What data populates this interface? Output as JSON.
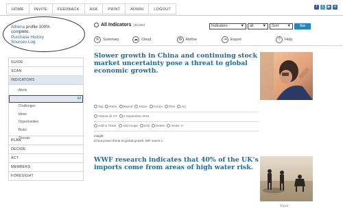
{
  "nav": [
    "HOME",
    "INVITE",
    "FEEDBACK",
    "ASK",
    "PRINT",
    "ADMIN",
    "LOGOUT"
  ],
  "social": [
    {
      "icon": "facebook-icon",
      "color": "#3b5998",
      "glyph": "f"
    },
    {
      "icon": "twitter-icon",
      "color": "#2aa9e0",
      "glyph": "t"
    },
    {
      "icon": "youtube-icon",
      "color": "#3a72b0",
      "glyph": "▶"
    },
    {
      "icon": "linkedin-icon",
      "color": "#1f6fa7",
      "glyph": "in"
    }
  ],
  "profile": {
    "line1_name": "Athena",
    "line1_rest": " profile 100%",
    "line2": "complete.",
    "link1": "Purchase History",
    "link2": "Sources Log"
  },
  "sidebar": {
    "top": [
      "GUIDE",
      "SCAN",
      "INDICATORS"
    ],
    "sub": [
      "Alerts",
      "All",
      "Challenges",
      "Ideas",
      "Opportunities",
      "Risks",
      "Threats"
    ],
    "selected_sub": "All",
    "bottom": [
      "PLAN",
      "DECIDE",
      "ACT",
      "MEMBERS",
      "FORESIGHT"
    ]
  },
  "main": {
    "title": "All Indicators",
    "count": "(35,869)",
    "filters": {
      "type": "Indicators",
      "scope": "all",
      "sort": "Sort",
      "go": "Go"
    },
    "actions": [
      {
        "label": "Summary",
        "icon": "summary-icon",
        "glyph": "≋"
      },
      {
        "label": "Cloud",
        "icon": "cloud-icon",
        "glyph": "☁"
      },
      {
        "label": "Refine",
        "icon": "refine-icon",
        "glyph": "⚙"
      },
      {
        "label": "Export",
        "icon": "export-icon",
        "glyph": "⇥"
      },
      {
        "label": "Help",
        "icon": "help-icon",
        "glyph": "?"
      }
    ]
  },
  "articles": [
    {
      "headline_lines": [
        "Slower growth in China and continuing stock",
        "market uncertainty pose a threat to global",
        "economic growth."
      ],
      "tools": [
        "Tag",
        "Refer",
        "Report",
        "Share",
        "Forum",
        "Plan",
        "Act"
      ],
      "author": "Athena @ ST",
      "date": "3 September 2015",
      "ops": [
        "Add to Ticker",
        "Add Image",
        "Edit",
        "Delete",
        "Views: 0"
      ],
      "insight_label": "Insight:",
      "insight_text": "China poses threat to global growth, IMF warns x"
    },
    {
      "headline_lines": [
        "WWF research indicates that 40% of the UK’s",
        "imports come from areas of high water risk."
      ],
      "caption": "Water"
    }
  ]
}
